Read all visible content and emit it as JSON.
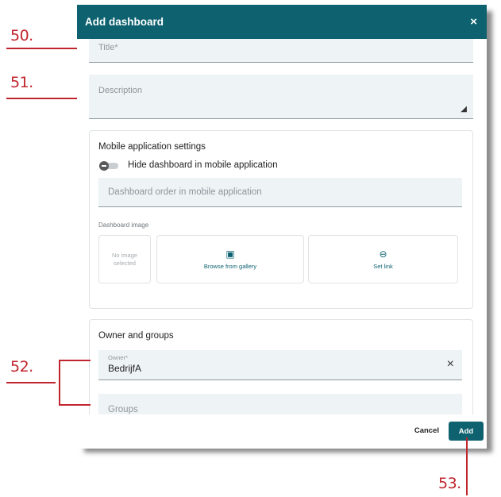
{
  "dialog": {
    "title": "Add dashboard",
    "close_icon": "×"
  },
  "fields": {
    "title_label": "Title*",
    "description_label": "Description",
    "description_resize": "◢"
  },
  "mobile_settings": {
    "heading": "Mobile application settings",
    "hide_toggle_label": "Hide dashboard in mobile application",
    "hide_toggle_on": false,
    "order_placeholder": "Dashboard order in mobile application",
    "image_label": "Dashboard image",
    "no_image_text": "No image selected",
    "browse_icon": "▣",
    "browse_label": "Browse from gallery",
    "link_icon": "⊖",
    "link_label": "Set link"
  },
  "owner_groups": {
    "heading": "Owner and groups",
    "owner_label": "Owner*",
    "owner_value": "BedrijfA",
    "owner_clear_icon": "×",
    "groups_placeholder": "Groups"
  },
  "footer": {
    "cancel_label": "Cancel",
    "add_label": "Add"
  },
  "callouts": [
    "50.",
    "51.",
    "52.",
    "53."
  ],
  "colors": {
    "header": "#0e6270",
    "callout": "#c0242c",
    "field_bg": "#eef3f6"
  }
}
